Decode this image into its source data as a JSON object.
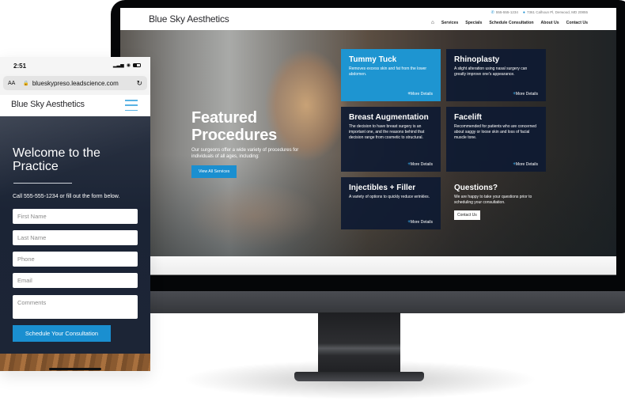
{
  "desktop": {
    "site": {
      "logo": "Blue Sky Aesthetics",
      "phone": "555-555-1234",
      "address": "7361 Calhoun Pl, Derwood, MD 20855",
      "nav": [
        "Services",
        "Specials",
        "Schedule Consultation",
        "About Us",
        "Contact Us"
      ]
    },
    "hero": {
      "title_line1": "Featured",
      "title_line2": "Procedures",
      "description": "Our surgeons offer a wide variety of procedures for individuals of all ages, including:",
      "button": "View All Services"
    },
    "cards": [
      {
        "title": "Tummy Tuck",
        "description": "Removes excess skin and fat from the lower abdomen.",
        "more": "More Details"
      },
      {
        "title": "Rhinoplasty",
        "description": "A slight alteration using nasal surgery can greatly improve one's appearance.",
        "more": "More Details"
      },
      {
        "title": "Breast Augmentation",
        "description": "The decision to have breast surgery is an important one, and the reasons behind that decision range from cosmetic to structural.",
        "more": "More Details"
      },
      {
        "title": "Facelift",
        "description": "Recommended for patients who are concerned about saggy or loose skin and loss of facial muscle tone.",
        "more": "More Details"
      },
      {
        "title": "Injectibles + Filler",
        "description": "A variety of options to quickly reduce wrinkles.",
        "more": "More Details"
      },
      {
        "title": "Questions?",
        "description": "We are happy to take your questions prior to scheduling your consultation.",
        "button": "Contact Us"
      }
    ],
    "colors": {
      "accent": "#1a8fd0",
      "card_dark": "#0e1a32"
    }
  },
  "mobile": {
    "status": {
      "time": "2:51"
    },
    "browser": {
      "text_size": "AA",
      "url": "blueskypreso.leadscience.com"
    },
    "site": {
      "logo": "Blue Sky Aesthetics"
    },
    "hero": {
      "title": "Welcome to the Practice",
      "subtitle": "Call 555-555-1234 or fill out the form below."
    },
    "form": {
      "fields": [
        {
          "placeholder": "First Name"
        },
        {
          "placeholder": "Last Name"
        },
        {
          "placeholder": "Phone"
        },
        {
          "placeholder": "Email"
        },
        {
          "placeholder": "Comments"
        }
      ],
      "submit": "Schedule Your Consultation"
    }
  }
}
